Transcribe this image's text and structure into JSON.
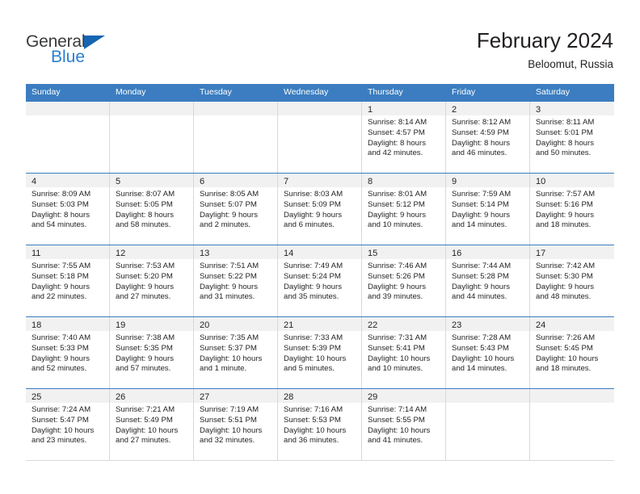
{
  "brand": {
    "name_top": "General",
    "name_bottom": "Blue",
    "triangle_color": "#1565b0",
    "blue_text_color": "#2b7fd1"
  },
  "header": {
    "title": "February 2024",
    "subtitle": "Beloomut, Russia"
  },
  "theme": {
    "header_row_bg": "#3b7dc0",
    "daynum_band_bg": "#f1f1f1",
    "grid_line": "#d8d8d8",
    "text": "#231f20"
  },
  "weekdays": [
    "Sunday",
    "Monday",
    "Tuesday",
    "Wednesday",
    "Thursday",
    "Friday",
    "Saturday"
  ],
  "weeks": [
    [
      {
        "day": "",
        "empty": true
      },
      {
        "day": "",
        "empty": true
      },
      {
        "day": "",
        "empty": true
      },
      {
        "day": "",
        "empty": true
      },
      {
        "day": "1",
        "sunrise": "Sunrise: 8:14 AM",
        "sunset": "Sunset: 4:57 PM",
        "daylight1": "Daylight: 8 hours",
        "daylight2": "and 42 minutes."
      },
      {
        "day": "2",
        "sunrise": "Sunrise: 8:12 AM",
        "sunset": "Sunset: 4:59 PM",
        "daylight1": "Daylight: 8 hours",
        "daylight2": "and 46 minutes."
      },
      {
        "day": "3",
        "sunrise": "Sunrise: 8:11 AM",
        "sunset": "Sunset: 5:01 PM",
        "daylight1": "Daylight: 8 hours",
        "daylight2": "and 50 minutes."
      }
    ],
    [
      {
        "day": "4",
        "sunrise": "Sunrise: 8:09 AM",
        "sunset": "Sunset: 5:03 PM",
        "daylight1": "Daylight: 8 hours",
        "daylight2": "and 54 minutes."
      },
      {
        "day": "5",
        "sunrise": "Sunrise: 8:07 AM",
        "sunset": "Sunset: 5:05 PM",
        "daylight1": "Daylight: 8 hours",
        "daylight2": "and 58 minutes."
      },
      {
        "day": "6",
        "sunrise": "Sunrise: 8:05 AM",
        "sunset": "Sunset: 5:07 PM",
        "daylight1": "Daylight: 9 hours",
        "daylight2": "and 2 minutes."
      },
      {
        "day": "7",
        "sunrise": "Sunrise: 8:03 AM",
        "sunset": "Sunset: 5:09 PM",
        "daylight1": "Daylight: 9 hours",
        "daylight2": "and 6 minutes."
      },
      {
        "day": "8",
        "sunrise": "Sunrise: 8:01 AM",
        "sunset": "Sunset: 5:12 PM",
        "daylight1": "Daylight: 9 hours",
        "daylight2": "and 10 minutes."
      },
      {
        "day": "9",
        "sunrise": "Sunrise: 7:59 AM",
        "sunset": "Sunset: 5:14 PM",
        "daylight1": "Daylight: 9 hours",
        "daylight2": "and 14 minutes."
      },
      {
        "day": "10",
        "sunrise": "Sunrise: 7:57 AM",
        "sunset": "Sunset: 5:16 PM",
        "daylight1": "Daylight: 9 hours",
        "daylight2": "and 18 minutes."
      }
    ],
    [
      {
        "day": "11",
        "sunrise": "Sunrise: 7:55 AM",
        "sunset": "Sunset: 5:18 PM",
        "daylight1": "Daylight: 9 hours",
        "daylight2": "and 22 minutes."
      },
      {
        "day": "12",
        "sunrise": "Sunrise: 7:53 AM",
        "sunset": "Sunset: 5:20 PM",
        "daylight1": "Daylight: 9 hours",
        "daylight2": "and 27 minutes."
      },
      {
        "day": "13",
        "sunrise": "Sunrise: 7:51 AM",
        "sunset": "Sunset: 5:22 PM",
        "daylight1": "Daylight: 9 hours",
        "daylight2": "and 31 minutes."
      },
      {
        "day": "14",
        "sunrise": "Sunrise: 7:49 AM",
        "sunset": "Sunset: 5:24 PM",
        "daylight1": "Daylight: 9 hours",
        "daylight2": "and 35 minutes."
      },
      {
        "day": "15",
        "sunrise": "Sunrise: 7:46 AM",
        "sunset": "Sunset: 5:26 PM",
        "daylight1": "Daylight: 9 hours",
        "daylight2": "and 39 minutes."
      },
      {
        "day": "16",
        "sunrise": "Sunrise: 7:44 AM",
        "sunset": "Sunset: 5:28 PM",
        "daylight1": "Daylight: 9 hours",
        "daylight2": "and 44 minutes."
      },
      {
        "day": "17",
        "sunrise": "Sunrise: 7:42 AM",
        "sunset": "Sunset: 5:30 PM",
        "daylight1": "Daylight: 9 hours",
        "daylight2": "and 48 minutes."
      }
    ],
    [
      {
        "day": "18",
        "sunrise": "Sunrise: 7:40 AM",
        "sunset": "Sunset: 5:33 PM",
        "daylight1": "Daylight: 9 hours",
        "daylight2": "and 52 minutes."
      },
      {
        "day": "19",
        "sunrise": "Sunrise: 7:38 AM",
        "sunset": "Sunset: 5:35 PM",
        "daylight1": "Daylight: 9 hours",
        "daylight2": "and 57 minutes."
      },
      {
        "day": "20",
        "sunrise": "Sunrise: 7:35 AM",
        "sunset": "Sunset: 5:37 PM",
        "daylight1": "Daylight: 10 hours",
        "daylight2": "and 1 minute."
      },
      {
        "day": "21",
        "sunrise": "Sunrise: 7:33 AM",
        "sunset": "Sunset: 5:39 PM",
        "daylight1": "Daylight: 10 hours",
        "daylight2": "and 5 minutes."
      },
      {
        "day": "22",
        "sunrise": "Sunrise: 7:31 AM",
        "sunset": "Sunset: 5:41 PM",
        "daylight1": "Daylight: 10 hours",
        "daylight2": "and 10 minutes."
      },
      {
        "day": "23",
        "sunrise": "Sunrise: 7:28 AM",
        "sunset": "Sunset: 5:43 PM",
        "daylight1": "Daylight: 10 hours",
        "daylight2": "and 14 minutes."
      },
      {
        "day": "24",
        "sunrise": "Sunrise: 7:26 AM",
        "sunset": "Sunset: 5:45 PM",
        "daylight1": "Daylight: 10 hours",
        "daylight2": "and 18 minutes."
      }
    ],
    [
      {
        "day": "25",
        "sunrise": "Sunrise: 7:24 AM",
        "sunset": "Sunset: 5:47 PM",
        "daylight1": "Daylight: 10 hours",
        "daylight2": "and 23 minutes."
      },
      {
        "day": "26",
        "sunrise": "Sunrise: 7:21 AM",
        "sunset": "Sunset: 5:49 PM",
        "daylight1": "Daylight: 10 hours",
        "daylight2": "and 27 minutes."
      },
      {
        "day": "27",
        "sunrise": "Sunrise: 7:19 AM",
        "sunset": "Sunset: 5:51 PM",
        "daylight1": "Daylight: 10 hours",
        "daylight2": "and 32 minutes."
      },
      {
        "day": "28",
        "sunrise": "Sunrise: 7:16 AM",
        "sunset": "Sunset: 5:53 PM",
        "daylight1": "Daylight: 10 hours",
        "daylight2": "and 36 minutes."
      },
      {
        "day": "29",
        "sunrise": "Sunrise: 7:14 AM",
        "sunset": "Sunset: 5:55 PM",
        "daylight1": "Daylight: 10 hours",
        "daylight2": "and 41 minutes."
      },
      {
        "day": "",
        "empty": true
      },
      {
        "day": "",
        "empty": true
      }
    ]
  ]
}
